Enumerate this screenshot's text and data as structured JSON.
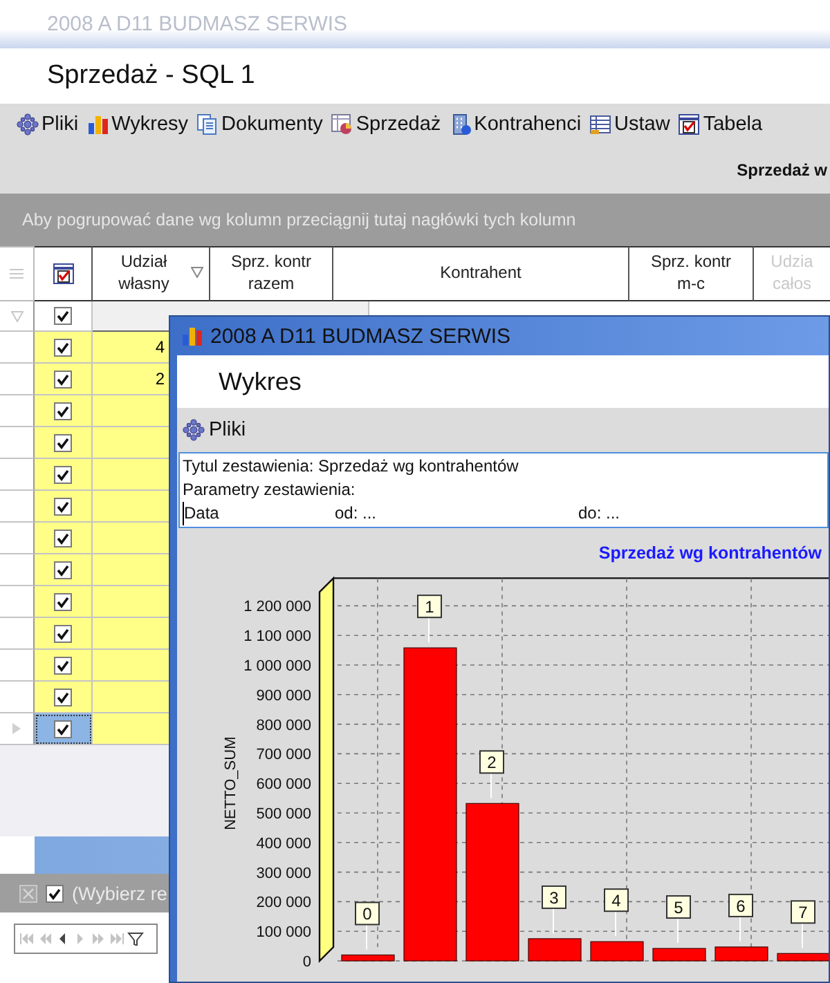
{
  "window": {
    "title": "2008 A D11 BUDMASZ SERWIS",
    "heading": "Sprzedaż - SQL 1"
  },
  "toolbar": [
    {
      "kind": "files",
      "label": "Pliki"
    },
    {
      "kind": "charts",
      "label": "Wykresy"
    },
    {
      "kind": "documents",
      "label": "Dokumenty"
    },
    {
      "kind": "sales",
      "label": "Sprzedaż"
    },
    {
      "kind": "contractors",
      "label": "Kontrahenci"
    },
    {
      "kind": "settings",
      "label": "Ustaw"
    },
    {
      "kind": "table",
      "label": "Tabela"
    }
  ],
  "report_title": "Sprzedaż w",
  "group_panel": "Aby pogrupować dane wg kolumn przeciągnij tutaj nagłówki tych kolumn",
  "grid": {
    "columns": [
      {
        "label": "Udział własny",
        "filter": true
      },
      {
        "label": "Sprz. kontr razem",
        "filter": false
      },
      {
        "label": "Kontrahent",
        "filter": false
      },
      {
        "label": "Sprz. kontr m-c",
        "filter": false
      },
      {
        "label": "Udzia całos",
        "filter": false
      }
    ],
    "filter_row": {
      "checked": true
    },
    "rows": [
      {
        "checked": true,
        "selected": false,
        "udzial": "4"
      },
      {
        "checked": true,
        "selected": false,
        "udzial": "2"
      },
      {
        "checked": true,
        "selected": false
      },
      {
        "checked": true,
        "selected": false
      },
      {
        "checked": true,
        "selected": false
      },
      {
        "checked": true,
        "selected": false
      },
      {
        "checked": true,
        "selected": false
      },
      {
        "checked": true,
        "selected": false
      },
      {
        "checked": true,
        "selected": false
      },
      {
        "checked": true,
        "selected": false
      },
      {
        "checked": true,
        "selected": false
      },
      {
        "checked": true,
        "selected": false
      },
      {
        "checked": true,
        "selected": true
      }
    ]
  },
  "filter_bar": {
    "checked": true,
    "text": "(Wybierz re"
  },
  "navigator": [
    {
      "kind": "first",
      "disabled": true
    },
    {
      "kind": "prev-page",
      "disabled": true
    },
    {
      "kind": "prev",
      "disabled": false
    },
    {
      "kind": "next",
      "disabled": true
    },
    {
      "kind": "next-page",
      "disabled": true
    },
    {
      "kind": "last",
      "disabled": true
    },
    {
      "kind": "filter",
      "disabled": false
    }
  ],
  "dialog": {
    "title": "2008 A D11 BUDMASZ SERWIS",
    "heading": "Wykres",
    "toolbar": [
      {
        "kind": "files",
        "label": "Pliki"
      }
    ],
    "info": {
      "title_line": "Tytul zestawienia: Sprzedaż wg kontrahentów",
      "params_line": "Parametry zestawienia:",
      "date_label": "Data",
      "from": "od: ...",
      "to": "do: ..."
    },
    "chart_data": {
      "type": "bar",
      "title": "Sprzedaż wg kontrahentów",
      "ylabel": "NETTO_SUM",
      "categories": [
        "0",
        "1",
        "2",
        "3",
        "4",
        "5",
        "6",
        "7"
      ],
      "series": [
        {
          "color": "#ff0000",
          "values": [
            20000,
            1058000,
            532000,
            75000,
            65000,
            42000,
            47000,
            25000
          ]
        }
      ],
      "ylim": [
        0,
        1200000
      ],
      "grid": true,
      "yticks": [
        {
          "value": 0,
          "label": "0"
        },
        {
          "value": 100000,
          "label": "100 000"
        },
        {
          "value": 200000,
          "label": "200 000"
        },
        {
          "value": 300000,
          "label": "300 000"
        },
        {
          "value": 400000,
          "label": "400 000"
        },
        {
          "value": 500000,
          "label": "500 000"
        },
        {
          "value": 600000,
          "label": "600 000"
        },
        {
          "value": 700000,
          "label": "700 000"
        },
        {
          "value": 800000,
          "label": "800 000"
        },
        {
          "value": 900000,
          "label": "900 000"
        },
        {
          "value": 1000000,
          "label": "1 000 000"
        },
        {
          "value": 1100000,
          "label": "1 100 000"
        },
        {
          "value": 1200000,
          "label": "1 200 000"
        }
      ]
    }
  }
}
